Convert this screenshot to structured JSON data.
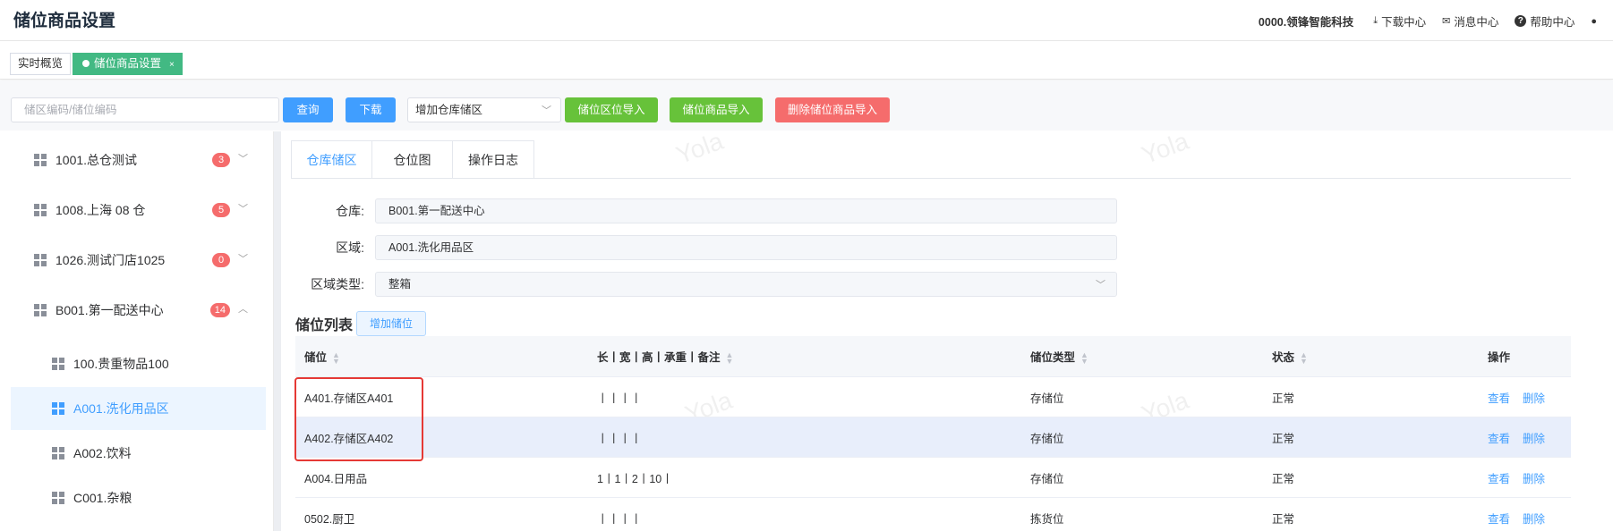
{
  "page": {
    "title": "储位商品设置"
  },
  "topbar": {
    "company": "0000.领锋智能科技",
    "download_center": "下载中心",
    "message_center": "消息中心",
    "help_center": "帮助中心"
  },
  "page_tabs": [
    {
      "label": "实时概览",
      "active": false
    },
    {
      "label": "储位商品设置",
      "active": true,
      "close": "×"
    }
  ],
  "filter": {
    "search_placeholder": "储区编码/储位编码",
    "query_label": "查询",
    "download_label": "下载",
    "select_value": "增加仓库储区",
    "import_area_label": "储位区位导入",
    "import_goods_label": "储位商品导入",
    "delete_import_label": "删除储位商品导入"
  },
  "sidebar": {
    "items": [
      {
        "label": "1001.总仓测试",
        "badge": "3",
        "chevron": "﹀"
      },
      {
        "label": "1008.上海 08 仓",
        "badge": "5",
        "chevron": "﹀"
      },
      {
        "label": "1026.测试门店1025",
        "badge": "0",
        "chevron": "﹀"
      },
      {
        "label": "B001.第一配送中心",
        "badge": "14",
        "chevron": "︿"
      },
      {
        "label": "100.贵重物品100"
      },
      {
        "label": "A001.洗化用品区",
        "active": true
      },
      {
        "label": "A002.饮料"
      },
      {
        "label": "C001.杂粮"
      }
    ]
  },
  "tabs": [
    {
      "label": "仓库储区",
      "active": true
    },
    {
      "label": "仓位图"
    },
    {
      "label": "操作日志"
    }
  ],
  "form": {
    "warehouse_label": "仓库:",
    "warehouse_value": "B001.第一配送中心",
    "area_label": "区域:",
    "area_value": "A001.洗化用品区",
    "type_label": "区域类型:",
    "type_value": "整箱"
  },
  "list": {
    "title": "储位列表",
    "add_label": "增加储位",
    "headers": [
      "储位",
      "长丨宽丨高丨承重丨备注",
      "储位类型",
      "状态",
      "操作"
    ],
    "view_label": "查看",
    "delete_label": "删除",
    "rows": [
      {
        "loc": "A401.存储区A401",
        "dims": "丨丨丨丨",
        "type": "存储位",
        "status": "正常"
      },
      {
        "loc": "A402.存储区A402",
        "dims": "丨丨丨丨",
        "type": "存储位",
        "status": "正常"
      },
      {
        "loc": "A004.日用品",
        "dims": "1丨1丨2丨10丨",
        "type": "存储位",
        "status": "正常"
      },
      {
        "loc": "0502.厨卫",
        "dims": "丨丨丨丨",
        "type": "拣货位",
        "status": "正常"
      }
    ]
  },
  "watermark": "Yola",
  "colors": {
    "primary": "#409eff",
    "success": "#67c23a",
    "danger": "#f56c6c",
    "active_tab": "#42b983",
    "highlight": "#e53935"
  }
}
